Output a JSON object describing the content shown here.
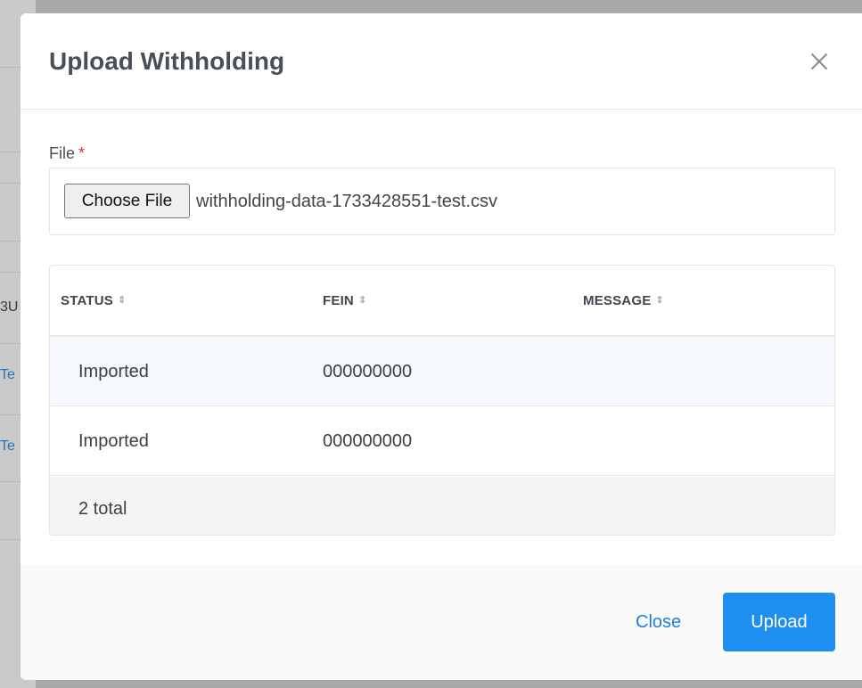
{
  "background": {
    "peek_texts": [
      "3U",
      "Te",
      "Te"
    ]
  },
  "modal": {
    "title": "Upload Withholding"
  },
  "file_field": {
    "label": "File",
    "required_mark": "*",
    "choose_button_label": "Choose File",
    "selected_file": "withholding-data-1733428551-test.csv"
  },
  "table": {
    "columns": [
      {
        "label": "STATUS",
        "sort_icon": "sort-updown-icon"
      },
      {
        "label": "FEIN",
        "sort_icon": "sort-updown-icon"
      },
      {
        "label": "MESSAGE",
        "sort_icon": "sort-updown-icon"
      }
    ],
    "rows": [
      {
        "status": "Imported",
        "fein": "000000000",
        "message": ""
      },
      {
        "status": "Imported",
        "fein": "000000000",
        "message": ""
      }
    ],
    "total_label": "2 total"
  },
  "footer": {
    "close_label": "Close",
    "upload_label": "Upload"
  },
  "colors": {
    "primary": "#1f8ef1",
    "link": "#1f7ee0",
    "required": "#e5303c"
  }
}
